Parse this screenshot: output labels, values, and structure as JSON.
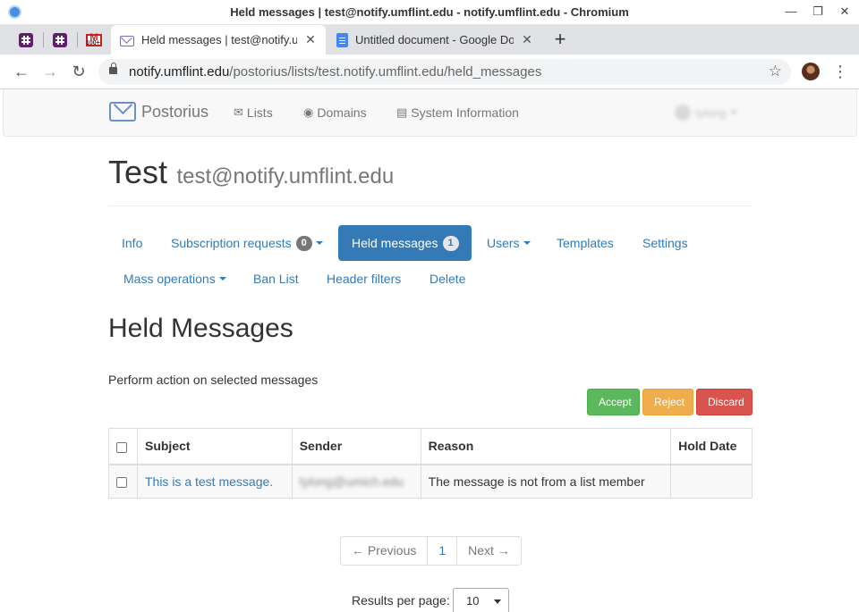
{
  "window": {
    "title": "Held messages | test@notify.umflint.edu - notify.umflint.edu - Chromium"
  },
  "tabs": [
    {
      "label": "Held messages | test@notify.umflint.edu",
      "active": true
    },
    {
      "label": "Untitled document - Google Docs",
      "active": false
    }
  ],
  "pinned_tabs": {
    "gmail_badge": "100+"
  },
  "address_bar": {
    "host": "notify.umflint.edu",
    "path": "/postorius/lists/test.notify.umflint.edu/held_messages"
  },
  "navbar": {
    "brand": "Postorius",
    "links": [
      "Lists",
      "Domains",
      "System Information"
    ],
    "user": "tylong"
  },
  "list": {
    "name": "Test",
    "address": "test@notify.umflint.edu"
  },
  "menu": {
    "info": "Info",
    "subscription_requests": "Subscription requests",
    "subscription_count": "0",
    "held_messages": "Held messages",
    "held_count": "1",
    "users": "Users",
    "templates": "Templates",
    "settings": "Settings",
    "mass_operations": "Mass operations",
    "ban_list": "Ban List",
    "header_filters": "Header filters",
    "delete": "Delete"
  },
  "held": {
    "heading": "Held Messages",
    "action_label": "Perform action on selected messages",
    "buttons": {
      "accept": "Accept",
      "reject": "Reject",
      "discard": "Discard"
    },
    "columns": [
      "Subject",
      "Sender",
      "Reason",
      "Hold Date"
    ],
    "rows": [
      {
        "subject": "This is a test message.",
        "sender": "tylong@umich.edu",
        "reason": "The message is not from a list member",
        "hold_date": ""
      }
    ]
  },
  "pagination": {
    "previous": "← Previous",
    "page": "1",
    "next": "Next →"
  },
  "results_per_page": {
    "label": "Results per page:",
    "value": "10"
  },
  "colors": {
    "primary": "#337ab7",
    "accept": "#5cb85c",
    "reject": "#f0ad4e",
    "discard": "#d9534f"
  }
}
